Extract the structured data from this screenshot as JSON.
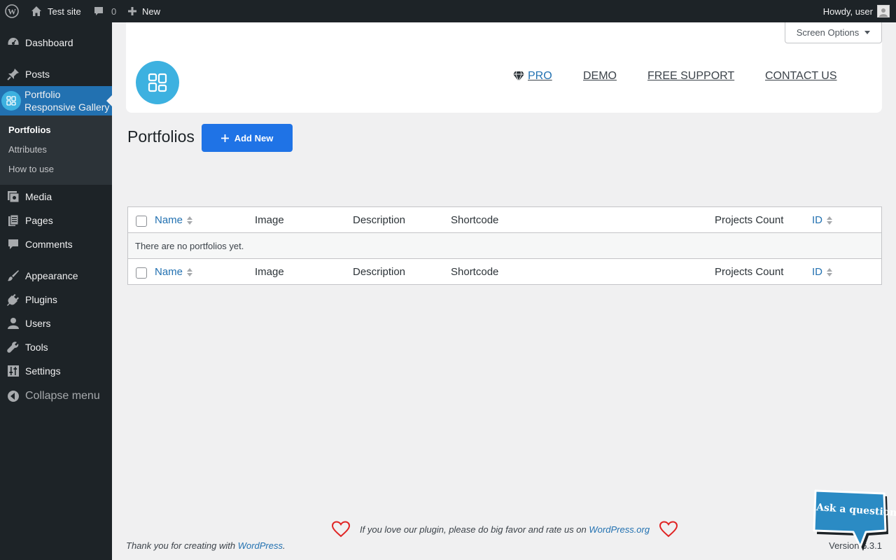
{
  "adminbar": {
    "site_name": "Test site",
    "comments_count": "0",
    "new_label": "New",
    "greeting": "Howdy, user"
  },
  "sidebar": {
    "items": [
      {
        "label": "Dashboard",
        "icon": "dashboard-icon"
      },
      {
        "label": "Posts",
        "icon": "pin-icon"
      },
      {
        "label": "Portfolio Responsive Gallery",
        "icon": "grid-icon"
      },
      {
        "label": "Media",
        "icon": "media-icon"
      },
      {
        "label": "Pages",
        "icon": "pages-icon"
      },
      {
        "label": "Comments",
        "icon": "comment-icon"
      },
      {
        "label": "Appearance",
        "icon": "brush-icon"
      },
      {
        "label": "Plugins",
        "icon": "plug-icon"
      },
      {
        "label": "Users",
        "icon": "user-icon"
      },
      {
        "label": "Tools",
        "icon": "wrench-icon"
      },
      {
        "label": "Settings",
        "icon": "sliders-icon"
      }
    ],
    "portfolio_label_line1": "Portfolio",
    "portfolio_label_line2": "Responsive Gallery",
    "submenu": [
      "Portfolios",
      "Attributes",
      "How to use"
    ],
    "collapse_label": "Collapse menu"
  },
  "plugin_header": {
    "links": {
      "pro": "PRO",
      "demo": "DEMO",
      "support": "FREE SUPPORT",
      "contact": "CONTACT US"
    }
  },
  "screen_options": "Screen Options",
  "page": {
    "title": "Portfolios",
    "add_new": "Add New"
  },
  "table": {
    "columns": [
      "Name",
      "Image",
      "Description",
      "Shortcode",
      "Projects Count",
      "ID"
    ],
    "empty_message": "There are no portfolios yet."
  },
  "footer": {
    "rate_text": "If you love our plugin, please do big favor and rate us on",
    "rate_link": "WordPress.org",
    "thanks_text": "Thank you for creating with",
    "thanks_link": "WordPress",
    "thanks_end": ".",
    "version": "Version 6.3.1"
  },
  "ask_bubble": "Ask a question",
  "colors": {
    "accent": "#2271b1",
    "admin_dark": "#1d2327",
    "add_button": "#1f73e6",
    "logo": "#3db1e0",
    "heart": "#e02424"
  }
}
